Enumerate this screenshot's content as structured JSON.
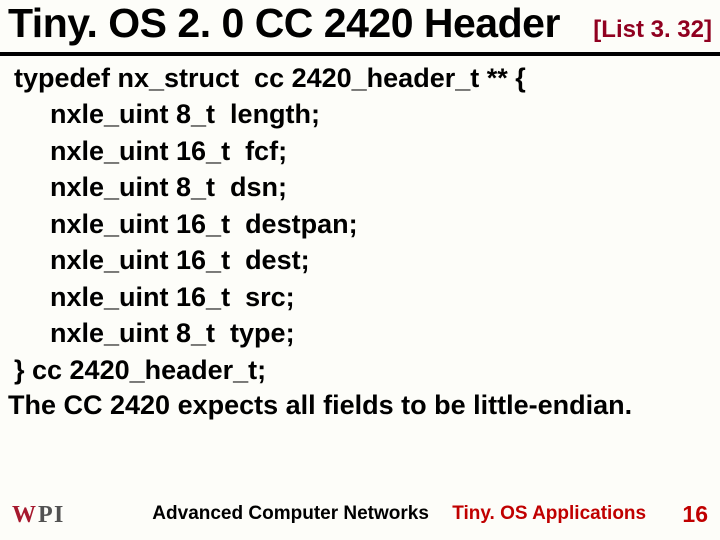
{
  "header": {
    "title": "Tiny. OS 2. 0 CC 2420 Header",
    "list_tag": "[List 3. 32]"
  },
  "code": {
    "l0": "typedef nx_struct  cc 2420_header_t ** {",
    "l1": "nxle_uint 8_t  length;",
    "l2": "nxle_uint 16_t  fcf;",
    "l3": "nxle_uint 8_t  dsn;",
    "l4": "nxle_uint 16_t  destpan;",
    "l5": "nxle_uint 16_t  dest;",
    "l6": "nxle_uint 16_t  src;",
    "l7": "nxle_uint 8_t  type;",
    "l8": "} cc 2420_header_t;"
  },
  "note": "The CC 2420 expects all fields to be little-endian.",
  "footer": {
    "course": "Advanced Computer Networks",
    "topic": "Tiny. OS Applications",
    "page": "16",
    "logo_text": "WPI"
  }
}
